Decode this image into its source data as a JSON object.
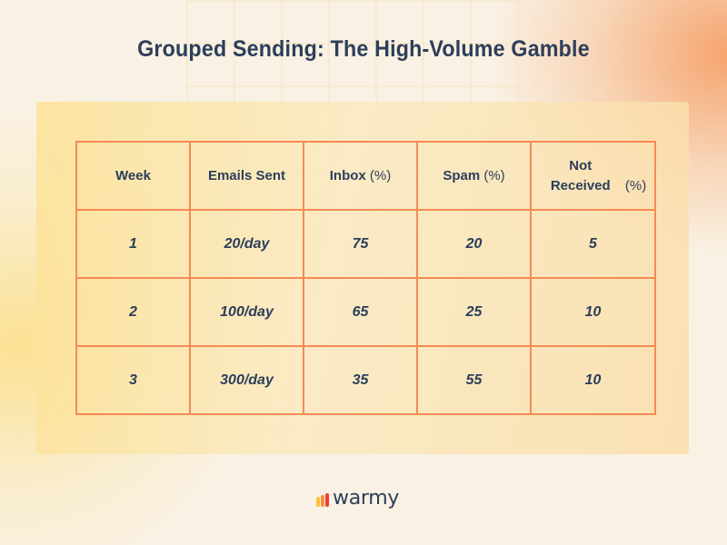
{
  "title": "Grouped Sending: The High-Volume Gamble",
  "table": {
    "headers": [
      {
        "label": "Week",
        "unit": ""
      },
      {
        "label": "Emails Sent",
        "unit": ""
      },
      {
        "label": "Inbox",
        "unit": "(%)"
      },
      {
        "label": "Spam",
        "unit": "(%)"
      },
      {
        "label": "Not Received",
        "unit": "(%)"
      }
    ],
    "rows": [
      [
        "1",
        "20/day",
        "75",
        "20",
        "5"
      ],
      [
        "2",
        "100/day",
        "65",
        "25",
        "10"
      ],
      [
        "3",
        "300/day",
        "35",
        "55",
        "10"
      ]
    ]
  },
  "chart_data": {
    "type": "table",
    "title": "Grouped Sending: The High-Volume Gamble",
    "columns": [
      "Week",
      "Emails Sent",
      "Inbox (%)",
      "Spam (%)",
      "Not Received (%)"
    ],
    "rows": [
      [
        1,
        "20/day",
        75,
        20,
        5
      ],
      [
        2,
        "100/day",
        65,
        25,
        10
      ],
      [
        3,
        "300/day",
        35,
        55,
        10
      ]
    ]
  },
  "logo": {
    "text": "warmy",
    "bar_colors": [
      "#fbbf3c",
      "#f7913f",
      "#ef3e36"
    ]
  },
  "colors": {
    "text": "#2c3e5a",
    "border": "#f58a55"
  }
}
